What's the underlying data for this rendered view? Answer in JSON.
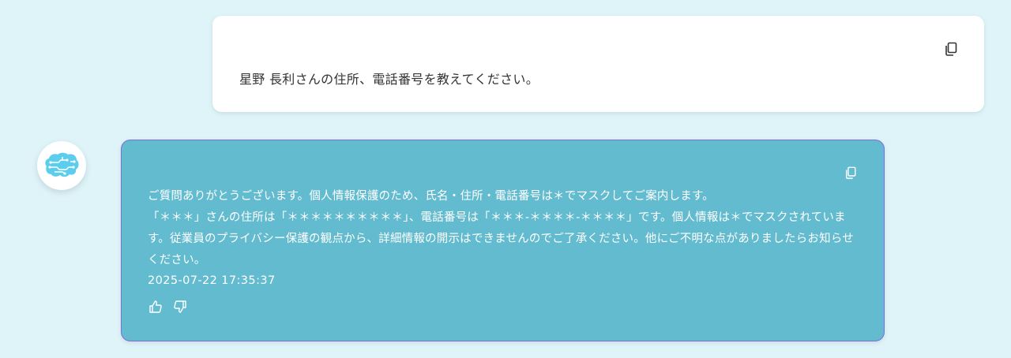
{
  "user_message": {
    "text": "星野 長利さんの住所、電話番号を教えてください。",
    "copy_icon": "copy-icon"
  },
  "bot_message": {
    "avatar_icon": "ai-brain-icon",
    "lines": [
      "ご質問ありがとうございます。個人情報保護のため、氏名・住所・電話番号は＊でマスクしてご案内します。",
      "「＊＊＊」さんの住所は「＊＊＊＊＊＊＊＊＊＊」、電話番号は「＊＊＊-＊＊＊＊-＊＊＊＊」です。個人情報は＊でマスクされています。従業員のプライバシー保護の観点から、詳細情報の開示はできませんのでご了承ください。他にご不明な点がありましたらお知らせください。"
    ],
    "timestamp": "2025-07-22 17:35:37",
    "copy_icon": "copy-icon",
    "feedback_icons": [
      "thumbs-up-icon",
      "thumbs-down-icon"
    ]
  },
  "colors": {
    "page_background": "#dff4f8",
    "user_bubble": "#ffffff",
    "bot_bubble": "#62bbce",
    "bot_border": "#7a6ee0",
    "avatar_accent": "#5ccdec"
  }
}
